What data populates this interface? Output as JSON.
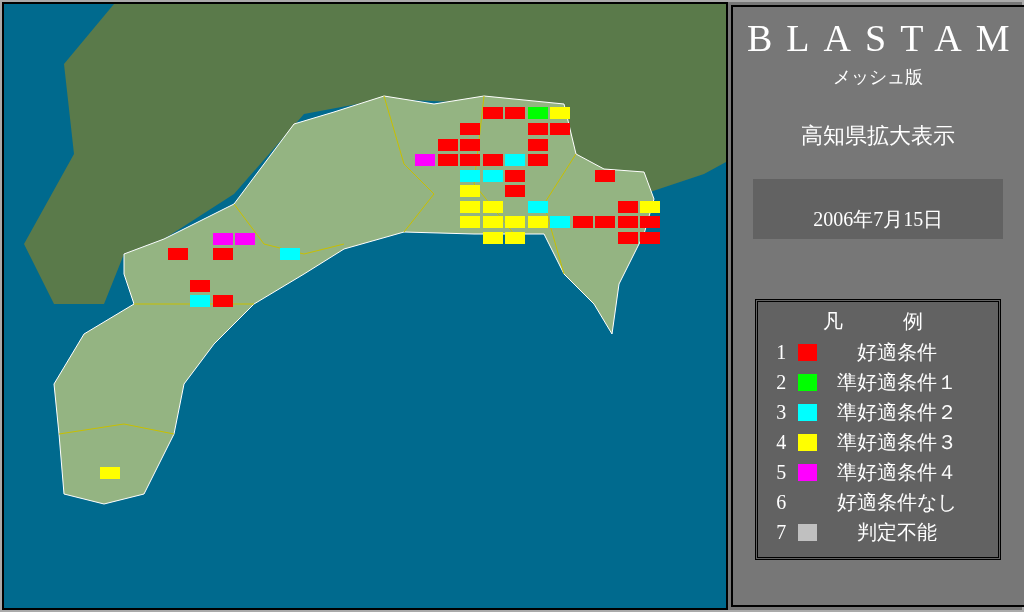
{
  "panel": {
    "title": "BLASTAM",
    "subtitle": "メッシュ版",
    "region": "高知県拡大表示",
    "date": "2006年7月15日"
  },
  "legend": {
    "title": "凡　例",
    "items": [
      {
        "number": "1",
        "label": "好適条件",
        "color": "#ff0000"
      },
      {
        "number": "2",
        "label": "準好適条件１",
        "color": "#00ff00"
      },
      {
        "number": "3",
        "label": "準好適条件２",
        "color": "#00ffff"
      },
      {
        "number": "4",
        "label": "準好適条件３",
        "color": "#ffff00"
      },
      {
        "number": "5",
        "label": "準好適条件４",
        "color": "#ff00ff"
      },
      {
        "number": "6",
        "label": "好適条件なし"
      },
      {
        "number": "7",
        "label": "判定不能",
        "color": "#c0c0c0"
      }
    ]
  }
}
